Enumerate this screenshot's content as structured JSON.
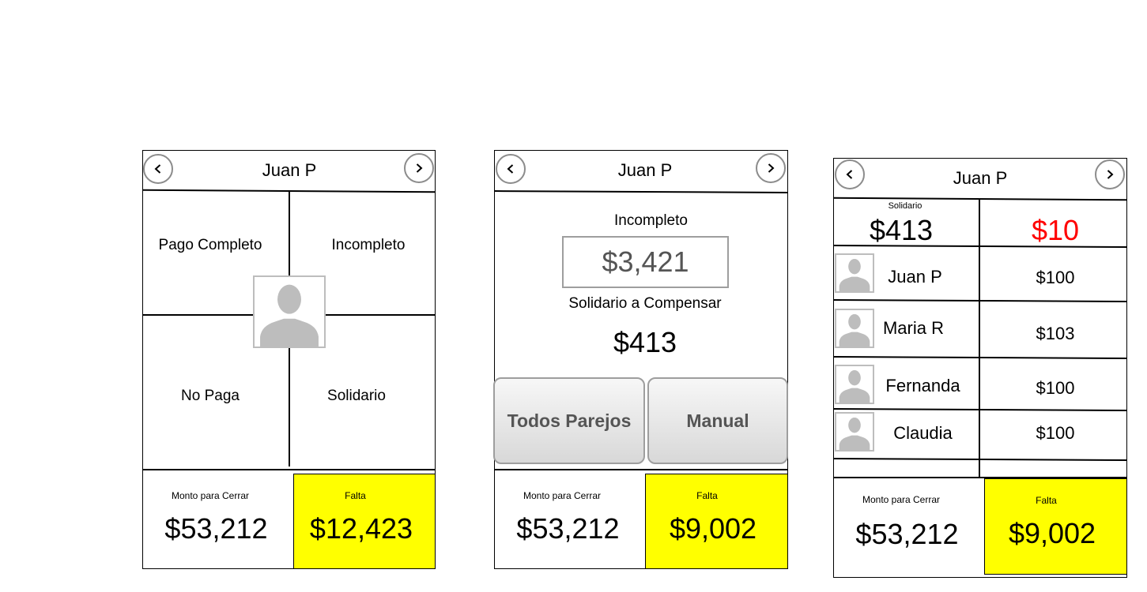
{
  "screen1": {
    "title": "Juan P",
    "options": [
      "Pago Completo",
      "Incompleto",
      "No Paga",
      "Solidario"
    ],
    "footer": {
      "monto_label": "Monto para Cerrar",
      "monto_value": "$53,212",
      "falta_label": "Falta",
      "falta_value": "$12,423"
    }
  },
  "screen2": {
    "title": "Juan P",
    "incompleto_label": "Incompleto",
    "incompleto_value": "$3,421",
    "solidario_label": "Solidario a Compensar",
    "solidario_value": "$413",
    "buttons": [
      "Todos Parejos",
      "Manual"
    ],
    "footer": {
      "monto_label": "Monto para Cerrar",
      "monto_value": "$53,212",
      "falta_label": "Falta",
      "falta_value": "$9,002"
    }
  },
  "screen3": {
    "title": "Juan P",
    "solidario_label": "Solidario",
    "solidario_value": "$413",
    "remaining_value": "$10",
    "rows": [
      {
        "name": "Juan P",
        "amount": "$100"
      },
      {
        "name": "Maria R",
        "amount": "$103"
      },
      {
        "name": "Fernanda",
        "amount": "$100"
      },
      {
        "name": "Claudia",
        "amount": "$100"
      }
    ],
    "footer": {
      "monto_label": "Monto para Cerrar",
      "monto_value": "$53,212",
      "falta_label": "Falta",
      "falta_value": "$9,002"
    }
  },
  "colors": {
    "highlight": "#ffff00",
    "negative": "#ff0000"
  },
  "icons": [
    "chevron-left-icon",
    "chevron-right-icon",
    "person-avatar-icon"
  ]
}
